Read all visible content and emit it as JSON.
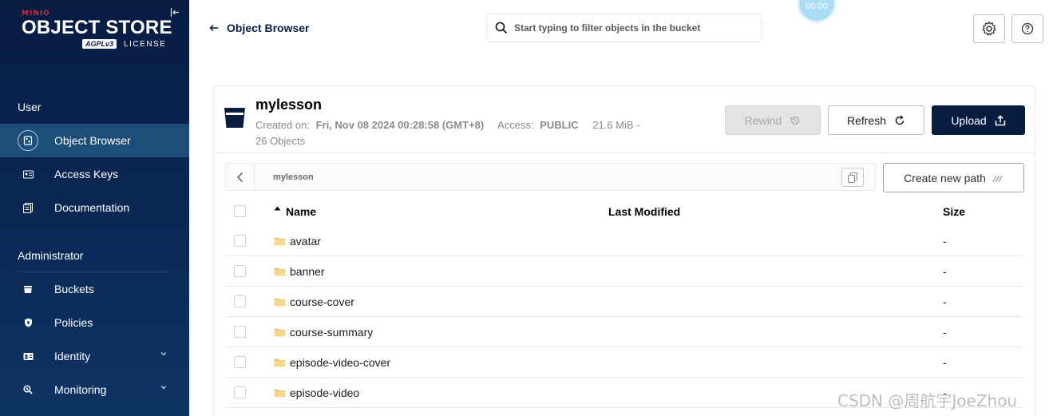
{
  "app": {
    "brand_top": "MINIO",
    "brand_main": "OBJECT STORE",
    "brand_badge": "AGPLv3",
    "brand_license": "LICENSE",
    "accent_color": "#c72c48",
    "sidebar_color": "#081c42"
  },
  "sidebar": {
    "user_section": "User",
    "admin_section": "Administrator",
    "user_items": [
      {
        "label": "Object Browser",
        "icon": "object-browser-icon",
        "active": true
      },
      {
        "label": "Access Keys",
        "icon": "access-keys-icon",
        "active": false
      },
      {
        "label": "Documentation",
        "icon": "documentation-icon",
        "active": false
      }
    ],
    "admin_items": [
      {
        "label": "Buckets",
        "icon": "buckets-icon"
      },
      {
        "label": "Policies",
        "icon": "policies-icon"
      },
      {
        "label": "Identity",
        "icon": "identity-icon",
        "expandable": true
      },
      {
        "label": "Monitoring",
        "icon": "monitoring-icon",
        "expandable": true
      }
    ]
  },
  "topbar": {
    "back_label": "Object Browser",
    "search_placeholder": "Start typing to filter objects in the bucket",
    "timer": "00:00"
  },
  "bucket": {
    "name": "mylesson",
    "created_label": "Created on:",
    "created_value": "Fri, Nov 08 2024 00:28:58 (GMT+8)",
    "access_label": "Access:",
    "access_value": "PUBLIC",
    "size": "21.6 MiB -",
    "objects": "26 Objects"
  },
  "actions": {
    "rewind": "Rewind",
    "refresh": "Refresh",
    "upload": "Upload",
    "create_path": "Create new path"
  },
  "breadcrumb": {
    "path": "mylesson"
  },
  "table": {
    "headers": {
      "name": "Name",
      "modified": "Last Modified",
      "size": "Size"
    },
    "rows": [
      {
        "name": "avatar",
        "modified": "",
        "size": "-"
      },
      {
        "name": "banner",
        "modified": "",
        "size": "-"
      },
      {
        "name": "course-cover",
        "modified": "",
        "size": "-"
      },
      {
        "name": "course-summary",
        "modified": "",
        "size": "-"
      },
      {
        "name": "episode-video-cover",
        "modified": "",
        "size": "-"
      },
      {
        "name": "episode-video",
        "modified": "",
        "size": "-"
      }
    ]
  },
  "watermark": "CSDN @周航宇JoeZhou"
}
